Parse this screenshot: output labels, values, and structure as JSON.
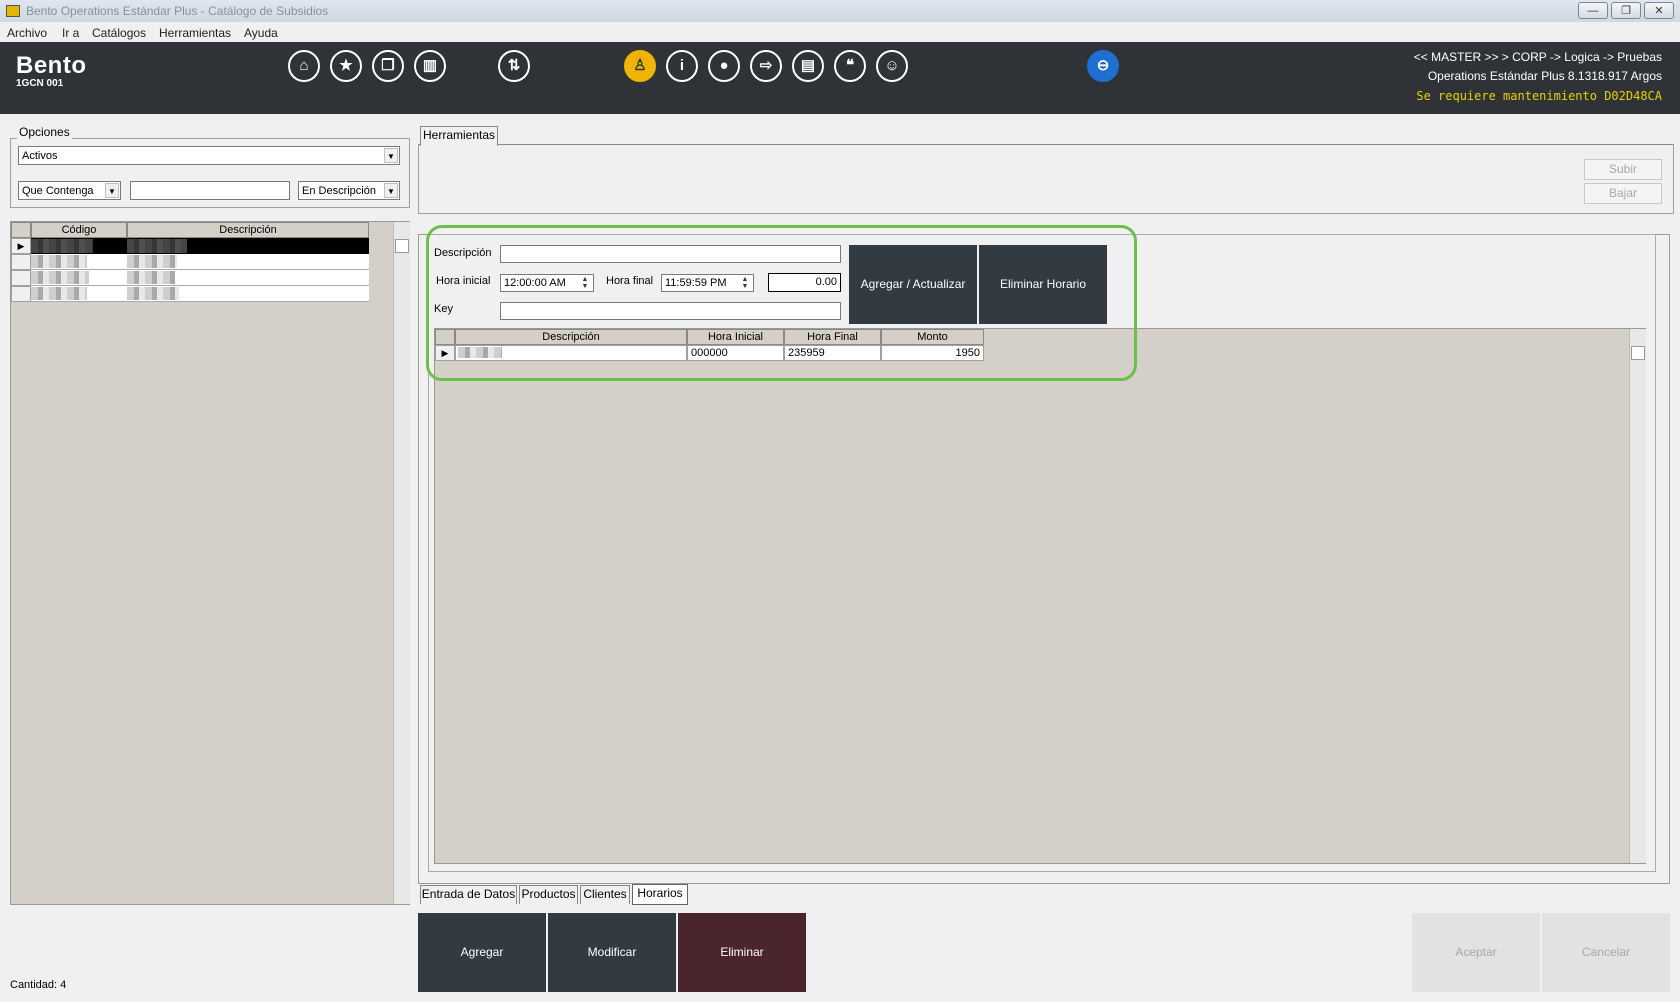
{
  "window": {
    "title": "Bento Operations Estándar Plus - Catálogo de Subsidios",
    "minimize": "—",
    "restore": "❐",
    "close": "✕"
  },
  "menu": [
    "Archivo",
    "Ir a",
    "Catálogos",
    "Herramientas",
    "Ayuda"
  ],
  "header": {
    "brand": "Bento",
    "branch": "1GCN 001",
    "path": "<< MASTER >> > CORP -> Logica -> Pruebas",
    "version": "Operations Estándar Plus 8.1318.917 Argos",
    "warning": "Se requiere mantenimiento D02D48CA"
  },
  "toolbar_icons": {
    "home": "⌂",
    "star": "★",
    "copy": "❐",
    "book": "▥",
    "sync": "⇅",
    "pin": "♙",
    "info": "i",
    "bulb": "●",
    "login": "⇨",
    "card": "▤",
    "quote": "❝",
    "users": "☺",
    "chat": "⊖"
  },
  "left": {
    "options_label": "Opciones",
    "status_filter": "Activos",
    "match_mode": "Que Contenga",
    "search_value": "",
    "search_field": "En Descripción",
    "columns": [
      "Código",
      "Descripción"
    ],
    "count_label": "Cantidad: 4"
  },
  "right": {
    "tools_tab": "Herramientas",
    "up_button": "Subir",
    "down_button": "Bajar",
    "form": {
      "desc_label": "Descripción",
      "desc_value": "",
      "start_label": "Hora inicial",
      "start_value": "12:00:00 AM",
      "end_label": "Hora final",
      "end_value": "11:59:59 PM",
      "amount_value": "0.00",
      "key_label": "Key",
      "key_value": "",
      "add_update_button": "Agregar / Actualizar",
      "delete_schedule_button": "Eliminar Horario"
    },
    "schedule_grid": {
      "columns": [
        "Descripción",
        "Hora Inicial",
        "Hora Final",
        "Monto"
      ],
      "rows": [
        {
          "descripcion": "",
          "hora_inicial": "000000",
          "hora_final": "235959",
          "monto": "1950"
        }
      ]
    },
    "tabs": [
      "Entrada de Datos",
      "Productos",
      "Clientes",
      "Horarios"
    ]
  },
  "actions": {
    "add": "Agregar",
    "modify": "Modificar",
    "delete": "Eliminar",
    "accept": "Aceptar",
    "cancel": "Cancelar"
  },
  "colors": {
    "header_bg": "#2f3337",
    "action_btn": "#323a42",
    "delete_btn": "#4a252b",
    "highlight": "#6cc04a",
    "warning": "#e8d000"
  }
}
